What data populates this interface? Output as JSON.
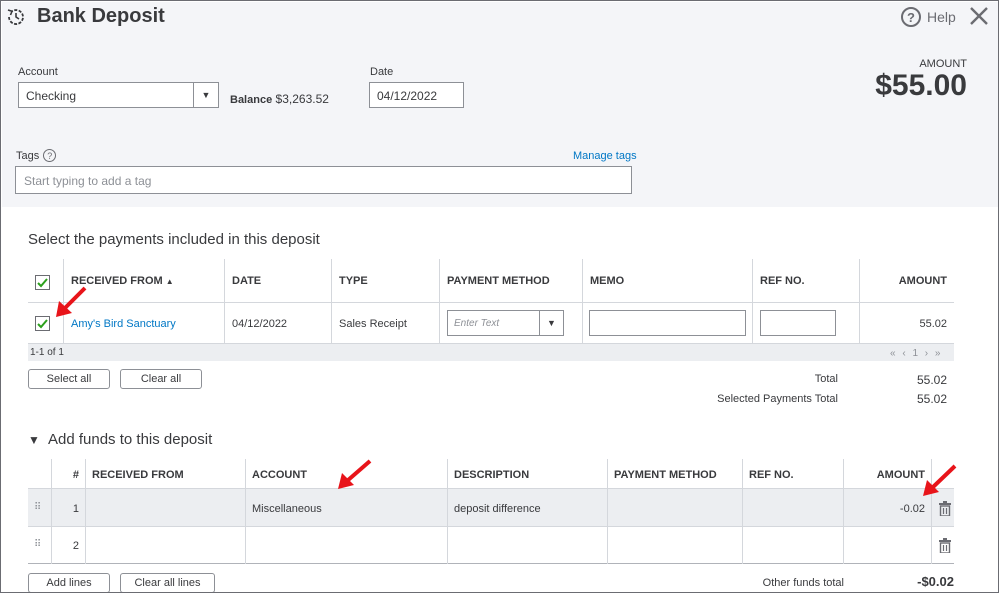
{
  "header": {
    "title": "Bank Deposit",
    "help_label": "Help"
  },
  "form": {
    "account_label": "Account",
    "account_value": "Checking",
    "balance_label": "Balance",
    "balance_value": "$3,263.52",
    "date_label": "Date",
    "date_value": "04/12/2022",
    "amount_label": "AMOUNT",
    "amount_value": "$55.00",
    "tags_label": "Tags",
    "manage_tags": "Manage tags",
    "tags_placeholder": "Start typing to add a tag"
  },
  "payments": {
    "title": "Select the payments included in this deposit",
    "columns": [
      "RECEIVED FROM",
      "DATE",
      "TYPE",
      "PAYMENT METHOD",
      "MEMO",
      "REF NO.",
      "AMOUNT"
    ],
    "sort_indicator": "▲",
    "rows": [
      {
        "received_from": "Amy's Bird Sanctuary",
        "date": "04/12/2022",
        "type": "Sales Receipt",
        "payment_method_placeholder": "Enter Text",
        "amount": "55.02",
        "checked": true
      }
    ],
    "page_info": "1-1 of 1",
    "pager": "« ‹ 1 › »",
    "select_all": "Select all",
    "clear_all": "Clear all",
    "total_label": "Total",
    "total_value": "55.02",
    "selected_total_label": "Selected Payments Total",
    "selected_total_value": "55.02"
  },
  "funds": {
    "title": "Add funds to this deposit",
    "columns": [
      "#",
      "RECEIVED FROM",
      "ACCOUNT",
      "DESCRIPTION",
      "PAYMENT METHOD",
      "REF NO.",
      "AMOUNT"
    ],
    "rows": [
      {
        "num": "1",
        "received_from": "",
        "account": "Miscellaneous",
        "description": "deposit difference",
        "payment_method": "",
        "ref_no": "",
        "amount": "-0.02"
      },
      {
        "num": "2",
        "received_from": "",
        "account": "",
        "description": "",
        "payment_method": "",
        "ref_no": "",
        "amount": ""
      }
    ],
    "add_lines": "Add lines",
    "clear_all_lines": "Clear all lines",
    "other_total_label": "Other funds total",
    "other_total_value": "-$0.02"
  },
  "colors": {
    "accent_link": "#0077c5",
    "check_green": "#2ca01c",
    "arrow_red": "#e8141a"
  }
}
